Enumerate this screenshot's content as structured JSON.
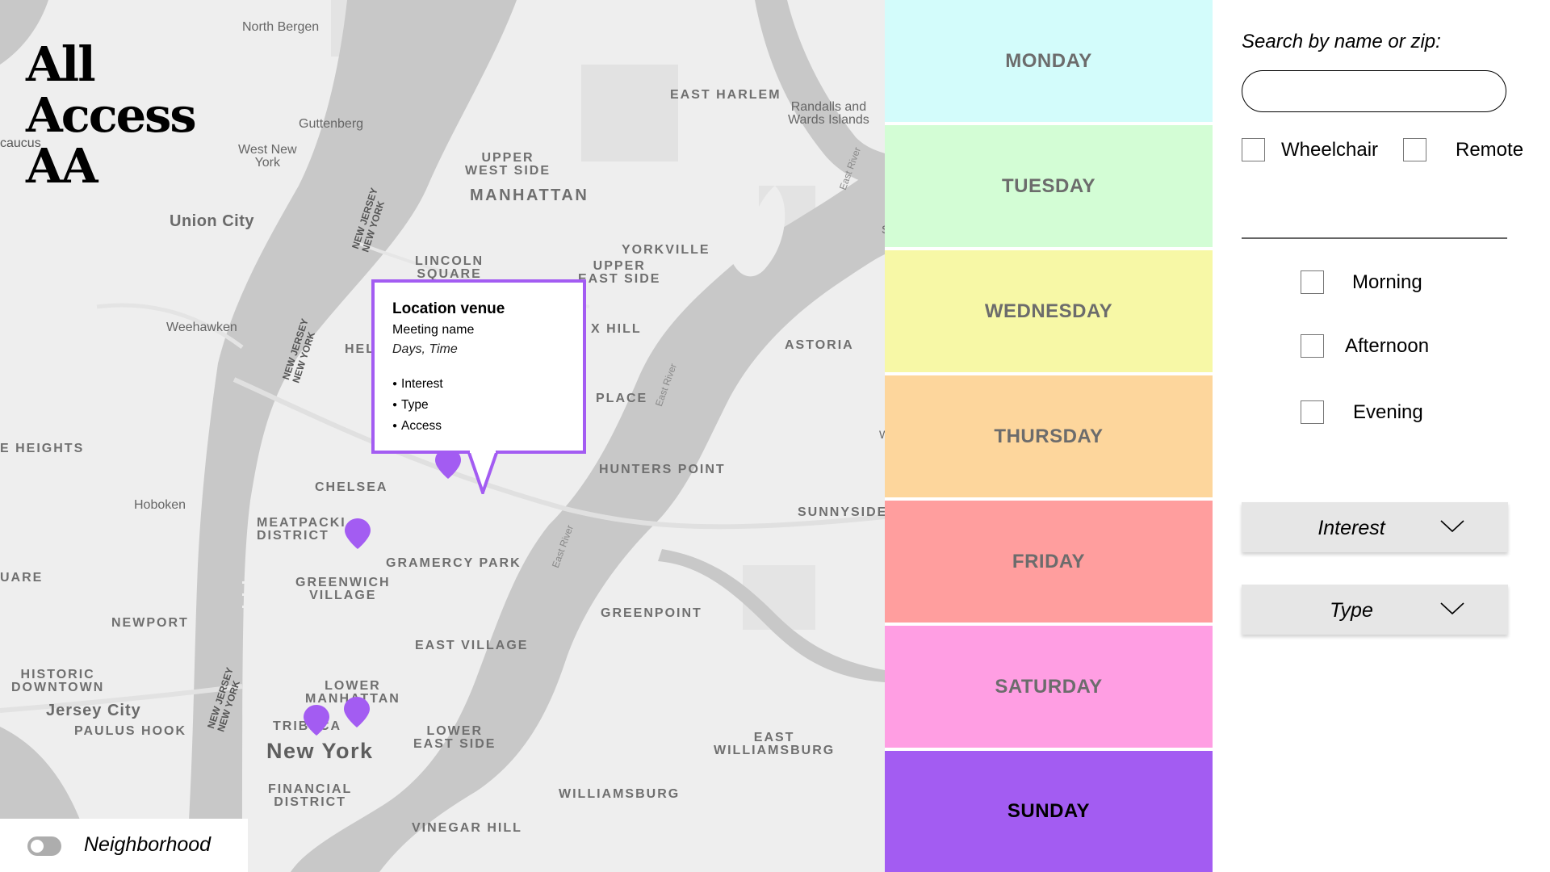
{
  "app": {
    "logo_lines": [
      "All",
      "Access",
      "AA"
    ]
  },
  "map": {
    "labels": {
      "north_bergen": "North Bergen",
      "guttenberg": "Guttenberg",
      "west_new_york": [
        "West New",
        "York"
      ],
      "union_city": "Union City",
      "weehawken": "Weehawken",
      "hoboken": "Hoboken",
      "heights": "E HEIGHTS",
      "caucus": "caucus",
      "quare": "UARE",
      "newport": "NEWPORT",
      "historic_downtown": [
        "HISTORIC",
        "DOWNTOWN"
      ],
      "jersey_city": "Jersey City",
      "paulus_hook": "PAULUS HOOK",
      "east_harlem": "EAST HARLEM",
      "randalls": [
        "Randalls and",
        "Wards Islands"
      ],
      "upper_west_side": [
        "UPPER",
        "WEST SIDE"
      ],
      "manhattan": "MANHATTAN",
      "lincoln_square": [
        "LINCOLN",
        "SQUARE"
      ],
      "yorkville": "YORKVILLE",
      "upper_east_side": [
        "UPPER",
        "EAST SIDE"
      ],
      "hill": "X HILL",
      "hel": "HEL",
      "astoria": "ASTORIA",
      "place": "PLACE",
      "hunters_point": "HUNTERS POINT",
      "chelsea": "CHELSEA",
      "sunnyside": "SUNNYSIDE",
      "meatpacking": [
        "MEATPACKI",
        "DISTRICT"
      ],
      "gramercy_park": "GRAMERCY PARK",
      "greenwich_village": [
        "GREENWICH",
        "VILLAGE"
      ],
      "greenpoint": "GREENPOINT",
      "east_village": "EAST VILLAGE",
      "lower_manhattan": [
        "LOWER",
        "MANHATTAN"
      ],
      "tribeca": "TRIBECA",
      "new_york": "New York",
      "lower_east_side": [
        "LOWER",
        "EAST SIDE"
      ],
      "east_williamsburg": [
        "EAST",
        "WILLIAMSBURG"
      ],
      "financial_district": [
        "FINANCIAL",
        "DISTRICT"
      ],
      "williamsburg": "WILLIAMSBURG",
      "vinegar_hill": "VINEGAR HILL",
      "nj_ny": [
        "NEW JERSEY",
        "NEW YORK"
      ],
      "east_river": "East River",
      "edge_s": "S",
      "edge_w": "W"
    },
    "popup": {
      "venue": "Location venue",
      "meeting": "Meeting name",
      "days_time": "Days, Time",
      "bullets": [
        "Interest",
        "Type",
        "Access"
      ]
    },
    "neighborhood_toggle": {
      "label": "Neighborhood",
      "on": false
    }
  },
  "days": [
    {
      "label": "MONDAY",
      "color": "#d3fcfb"
    },
    {
      "label": "TUESDAY",
      "color": "#d3fdd5"
    },
    {
      "label": "WEDNESDAY",
      "color": "#f7f8a6"
    },
    {
      "label": "THURSDAY",
      "color": "#fdd69c"
    },
    {
      "label": "FRIDAY",
      "color": "#ff9e9e"
    },
    {
      "label": "SATURDAY",
      "color": "#ff9ee3"
    },
    {
      "label": "SUNDAY",
      "color": "#a35cf2",
      "active": true
    }
  ],
  "filters": {
    "search_label": "Search by name or zip:",
    "search_value": "",
    "wheelchair": "Wheelchair",
    "remote": "Remote",
    "morning": "Morning",
    "afternoon": "Afternoon",
    "evening": "Evening",
    "interest": "Interest",
    "type": "Type"
  },
  "colors": {
    "accent": "#a35cf2",
    "map_land": "#eeeeee",
    "map_water": "#c7c7c7"
  }
}
